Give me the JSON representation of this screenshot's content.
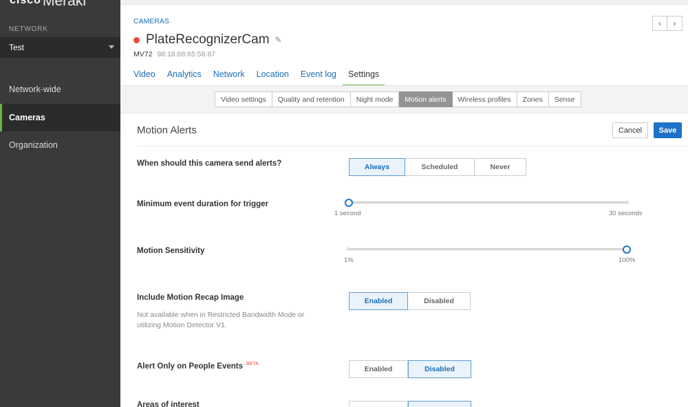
{
  "sidebar": {
    "brand_cisco": "cisco",
    "brand_meraki": "Meraki",
    "network_label": "NETWORK",
    "network_value": "Test",
    "items": [
      {
        "label": "Network-wide"
      },
      {
        "label": "Cameras"
      },
      {
        "label": "Organization"
      }
    ]
  },
  "header": {
    "breadcrumb": "CAMERAS",
    "camera_name": "PlateRecognizerCam",
    "model": "MV72",
    "mac": "98:18:88:65:58:87",
    "status_color": "#e84c3d",
    "tabs": [
      {
        "label": "Video"
      },
      {
        "label": "Analytics"
      },
      {
        "label": "Network"
      },
      {
        "label": "Location"
      },
      {
        "label": "Event log"
      },
      {
        "label": "Settings"
      }
    ]
  },
  "subnav": [
    {
      "label": "Video settings"
    },
    {
      "label": "Quality and retention"
    },
    {
      "label": "Night mode"
    },
    {
      "label": "Motion alerts"
    },
    {
      "label": "Wireless profiles"
    },
    {
      "label": "Zones"
    },
    {
      "label": "Sense"
    }
  ],
  "section": {
    "title": "Motion Alerts",
    "cancel_label": "Cancel",
    "save_label": "Save"
  },
  "settings": {
    "send_alerts": {
      "label": "When should this camera send alerts?",
      "options": [
        "Always",
        "Scheduled",
        "Never"
      ],
      "selected": "Always"
    },
    "min_duration": {
      "label": "Minimum event duration for trigger",
      "min_label": "1 second",
      "max_label": "30 seconds",
      "value_fraction": 0
    },
    "sensitivity": {
      "label": "Motion Sensitivity",
      "min_label": "1%",
      "max_label": "100%",
      "value_fraction": 1
    },
    "recap_image": {
      "label": "Include Motion Recap Image",
      "note": "Not available when in Restricted Bandwidth Mode or utilizing Motion Detector V1.",
      "options": [
        "Enabled",
        "Disabled"
      ],
      "selected": "Enabled"
    },
    "people_events": {
      "label": "Alert Only on People Events",
      "badge": "BETA",
      "options": [
        "Enabled",
        "Disabled"
      ],
      "selected": "Disabled"
    },
    "areas": {
      "label": "Areas of interest"
    }
  },
  "colors": {
    "accent": "#1d73c9",
    "active_nav": "#67b346",
    "sidebar_bg": "#3a3a3a"
  }
}
